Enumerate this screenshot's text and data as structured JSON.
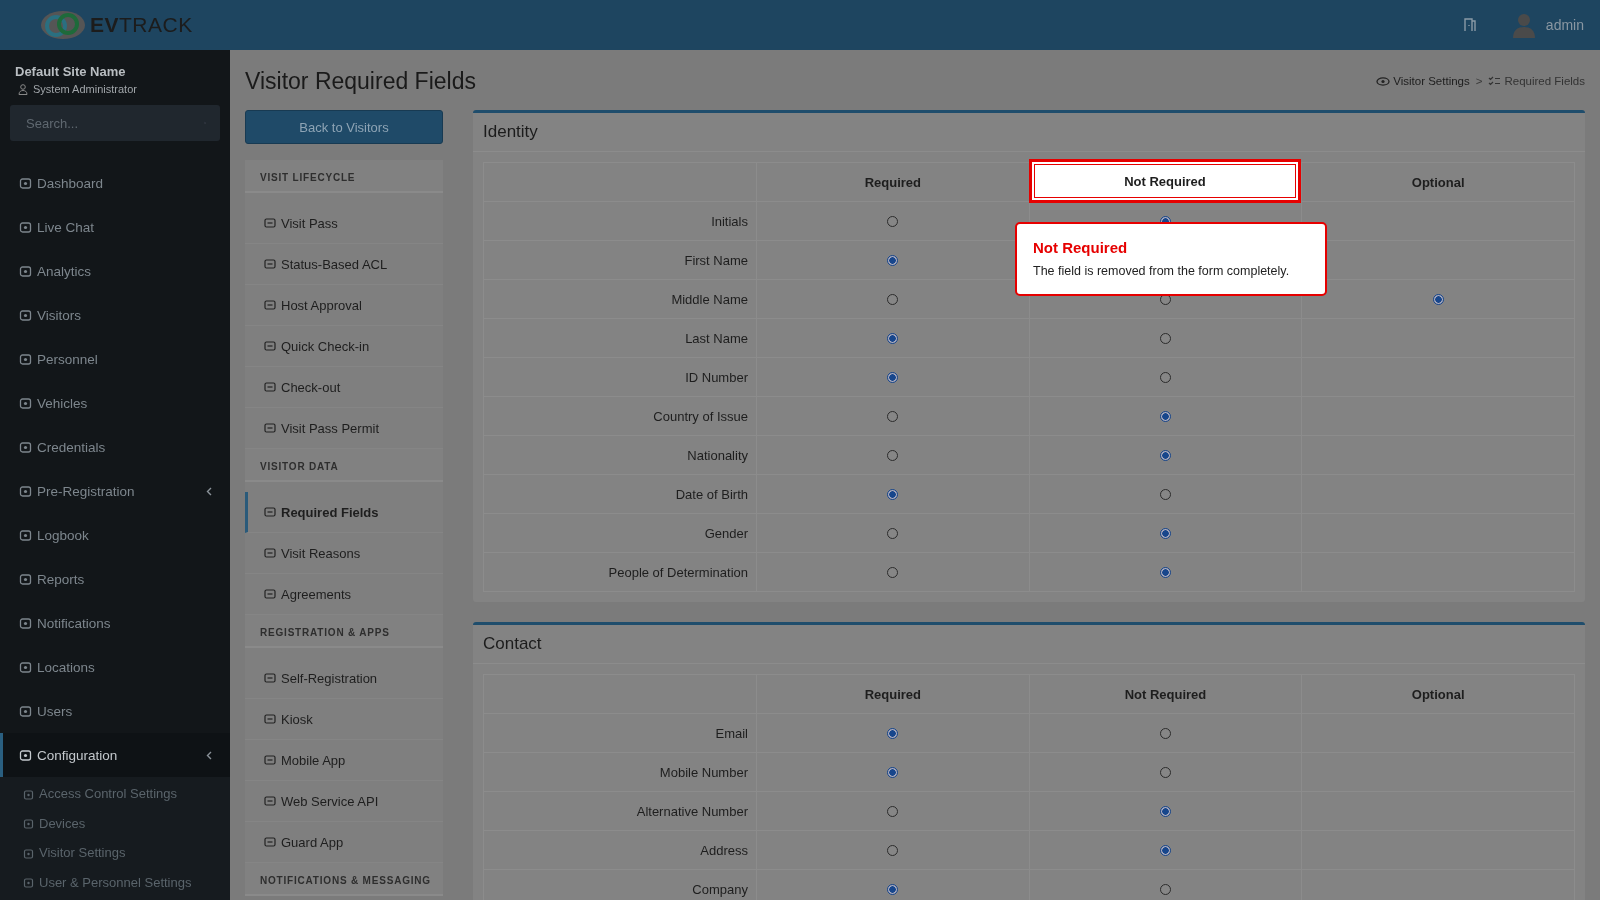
{
  "header": {
    "logo": {
      "strong": "EV",
      "light": "TRACK"
    },
    "user": "admin"
  },
  "sidebar": {
    "site": "Default Site Name",
    "role": "System Administrator",
    "search": {
      "placeholder": "Search..."
    },
    "items": [
      {
        "label": "Dashboard",
        "selected": false,
        "has_submenu": false
      },
      {
        "label": "Live Chat",
        "selected": false,
        "has_submenu": false
      },
      {
        "label": "Analytics",
        "selected": false,
        "has_submenu": false
      },
      {
        "label": "Visitors",
        "selected": false,
        "has_submenu": false
      },
      {
        "label": "Personnel",
        "selected": false,
        "has_submenu": false
      },
      {
        "label": "Vehicles",
        "selected": false,
        "has_submenu": false
      },
      {
        "label": "Credentials",
        "selected": false,
        "has_submenu": false
      },
      {
        "label": "Pre-Registration",
        "selected": false,
        "has_submenu": true
      },
      {
        "label": "Logbook",
        "selected": false,
        "has_submenu": false
      },
      {
        "label": "Reports",
        "selected": false,
        "has_submenu": false
      },
      {
        "label": "Notifications",
        "selected": false,
        "has_submenu": false
      },
      {
        "label": "Locations",
        "selected": false,
        "has_submenu": false
      },
      {
        "label": "Users",
        "selected": false,
        "has_submenu": false
      },
      {
        "label": "Configuration",
        "selected": true,
        "has_submenu": true,
        "children": [
          {
            "label": "Access Control Settings"
          },
          {
            "label": "Devices"
          },
          {
            "label": "Visitor Settings"
          },
          {
            "label": "User & Personnel Settings"
          }
        ]
      }
    ]
  },
  "page": {
    "title": "Visitor Required Fields",
    "back_button": "Back to Visitors",
    "breadcrumb": [
      "Visitor Settings",
      "Required Fields"
    ],
    "breadcrumb_separator": ">"
  },
  "menu": [
    {
      "heading": "VISIT LIFECYCLE",
      "items": [
        {
          "label": "Visit Pass",
          "selected": false
        },
        {
          "label": "Status-Based ACL",
          "selected": false
        },
        {
          "label": "Host Approval",
          "selected": false
        },
        {
          "label": "Quick Check-in",
          "selected": false
        },
        {
          "label": "Check-out",
          "selected": false
        },
        {
          "label": "Visit Pass Permit",
          "selected": false
        }
      ]
    },
    {
      "heading": "VISITOR DATA",
      "items": [
        {
          "label": "Required Fields",
          "selected": true
        },
        {
          "label": "Visit Reasons",
          "selected": false
        },
        {
          "label": "Agreements",
          "selected": false
        }
      ]
    },
    {
      "heading": "REGISTRATION & APPS",
      "items": [
        {
          "label": "Self-Registration",
          "selected": false
        },
        {
          "label": "Kiosk",
          "selected": false
        },
        {
          "label": "Mobile App",
          "selected": false
        },
        {
          "label": "Web Service API",
          "selected": false
        },
        {
          "label": "Guard App",
          "selected": false
        }
      ]
    },
    {
      "heading": "NOTIFICATIONS & MESSAGING"
    }
  ],
  "sections": [
    {
      "title": "Identity",
      "columns": [
        {
          "label": "Required",
          "highlighted": false
        },
        {
          "label": "Not Required",
          "highlighted": true
        },
        {
          "label": "Optional",
          "highlighted": false
        }
      ],
      "rows": [
        {
          "label": "Initials",
          "options": [
            {
              "selected": false
            },
            {
              "selected": true
            }
          ]
        },
        {
          "label": "First Name",
          "options": [
            {
              "selected": true
            }
          ]
        },
        {
          "label": "Middle Name",
          "options": [
            {
              "selected": false
            },
            {
              "selected": false
            },
            {
              "selected": true
            }
          ]
        },
        {
          "label": "Last Name",
          "options": [
            {
              "selected": true
            },
            {
              "selected": false
            }
          ]
        },
        {
          "label": "ID Number",
          "options": [
            {
              "selected": true
            },
            {
              "selected": false
            }
          ]
        },
        {
          "label": "Country of Issue",
          "options": [
            {
              "selected": false
            },
            {
              "selected": true
            }
          ]
        },
        {
          "label": "Nationality",
          "options": [
            {
              "selected": false
            },
            {
              "selected": true
            }
          ]
        },
        {
          "label": "Date of Birth",
          "options": [
            {
              "selected": true
            },
            {
              "selected": false
            }
          ]
        },
        {
          "label": "Gender",
          "options": [
            {
              "selected": false
            },
            {
              "selected": true
            }
          ]
        },
        {
          "label": "People of Determination",
          "options": [
            {
              "selected": false
            },
            {
              "selected": true
            }
          ]
        }
      ]
    },
    {
      "title": "Contact",
      "columns": [
        {
          "label": "Required",
          "highlighted": false
        },
        {
          "label": "Not Required",
          "highlighted": false
        },
        {
          "label": "Optional",
          "highlighted": false
        }
      ],
      "rows": [
        {
          "label": "Email",
          "options": [
            {
              "selected": true
            },
            {
              "selected": false
            }
          ]
        },
        {
          "label": "Mobile Number",
          "options": [
            {
              "selected": true
            },
            {
              "selected": false
            }
          ]
        },
        {
          "label": "Alternative Number",
          "options": [
            {
              "selected": false
            },
            {
              "selected": true
            }
          ]
        },
        {
          "label": "Address",
          "options": [
            {
              "selected": false
            },
            {
              "selected": true
            }
          ]
        },
        {
          "label": "Company",
          "options": [
            {
              "selected": true
            },
            {
              "selected": false
            }
          ]
        }
      ]
    }
  ],
  "tooltip": {
    "title": "Not Required",
    "text": "The field is removed from the form completely."
  }
}
